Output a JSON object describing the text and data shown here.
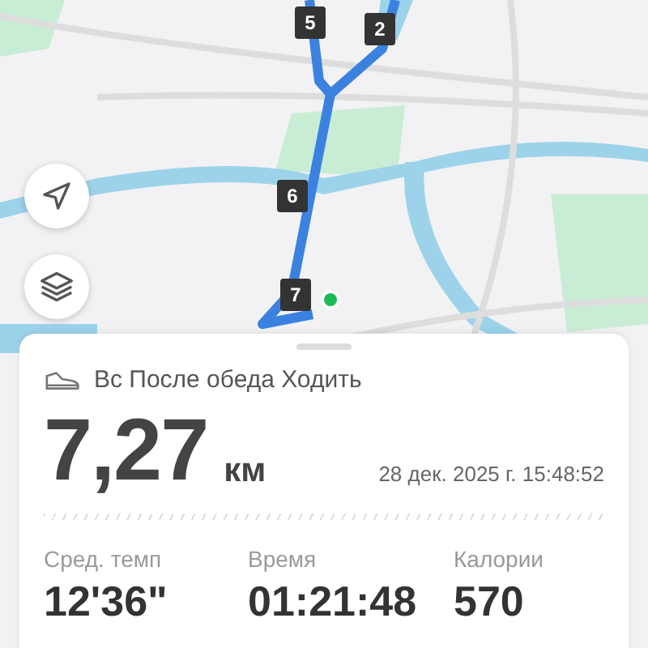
{
  "map": {
    "kind": "picture",
    "markers": [
      "5",
      "2",
      "6",
      "7"
    ]
  },
  "activity": {
    "title": "Вс После обеда Ходить",
    "distance": "7,27",
    "unit": "км",
    "datetime": "28 дек. 2025 г. 15:48:52",
    "stats": [
      {
        "label": "Сред. темп",
        "value": "12'36\""
      },
      {
        "label": "Время",
        "value": "01:21:48"
      },
      {
        "label": "Калории",
        "value": "570"
      }
    ]
  }
}
